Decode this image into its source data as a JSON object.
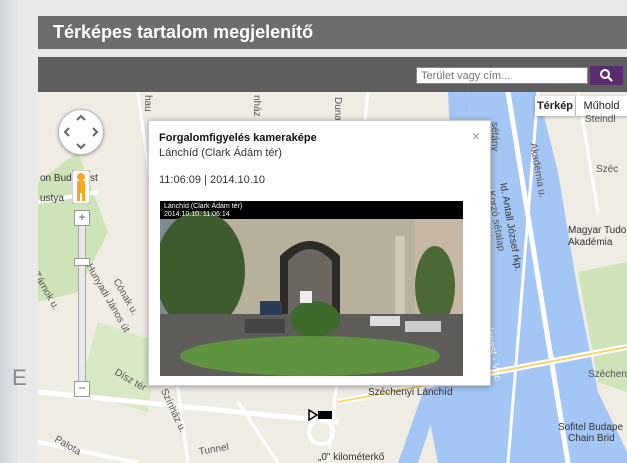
{
  "header": {
    "title": "Térképes tartalom megjelenítő"
  },
  "search": {
    "placeholder": "Terület vagy cím..."
  },
  "map": {
    "type_buttons": [
      "Térkép",
      "Műhold"
    ],
    "labels": {
      "steindl": "Steindl",
      "akademia": "Akadémia u.",
      "szec": "Széc",
      "antall": "Id. Antall József rkp.",
      "magyar_tud": "Magyar Tudo",
      "akademia2": "Akadémia",
      "budapest_vac": "Budapest - Vác",
      "szechenyi_r": "Széchenyi",
      "szechenyi_lanchid": "Széchenyi Lánchíd",
      "sofitel": "Sofitel Budape",
      "chain": "Chain Brid",
      "on_bud": "on Bud",
      "st": "st",
      "ustya": "ustya",
      "tarnok": "Tárnok u.",
      "hunyadi": "Hunyadi János út",
      "conak": "Cónak u.",
      "disz": "Dísz tér",
      "szinhaz": "Színház u.",
      "palota": "Palota",
      "tunnel": "Tunnel",
      "km": "„0\" kilométerkő",
      "duna_co": "Duna Co",
      "hau": "hau",
      "nhaz": "nház",
      "sello": "sétány",
      "korso": "Korzó sétalap",
      "e_left": "E"
    }
  },
  "infowindow": {
    "title": "Forgalomfigyelés kameraképe",
    "subtitle": "Lánchíd (Clark Ádám tér)",
    "timestamp": "11:06:09 | 2014.10.10",
    "close": "×",
    "camera_overlay_line1": "Lánchíd (Clark Ádám tér)",
    "camera_overlay_line2": "2014.10.10. 11:06:14"
  },
  "controls": {
    "zoom_in": "+",
    "zoom_out": "−"
  },
  "colors": {
    "accent": "#5b2c6f",
    "water": "#a4c6f4",
    "title_bar": "#6d6d6d"
  },
  "icons": [
    "search-icon",
    "pegman-icon",
    "pan-control-icon",
    "camera-icon"
  ]
}
